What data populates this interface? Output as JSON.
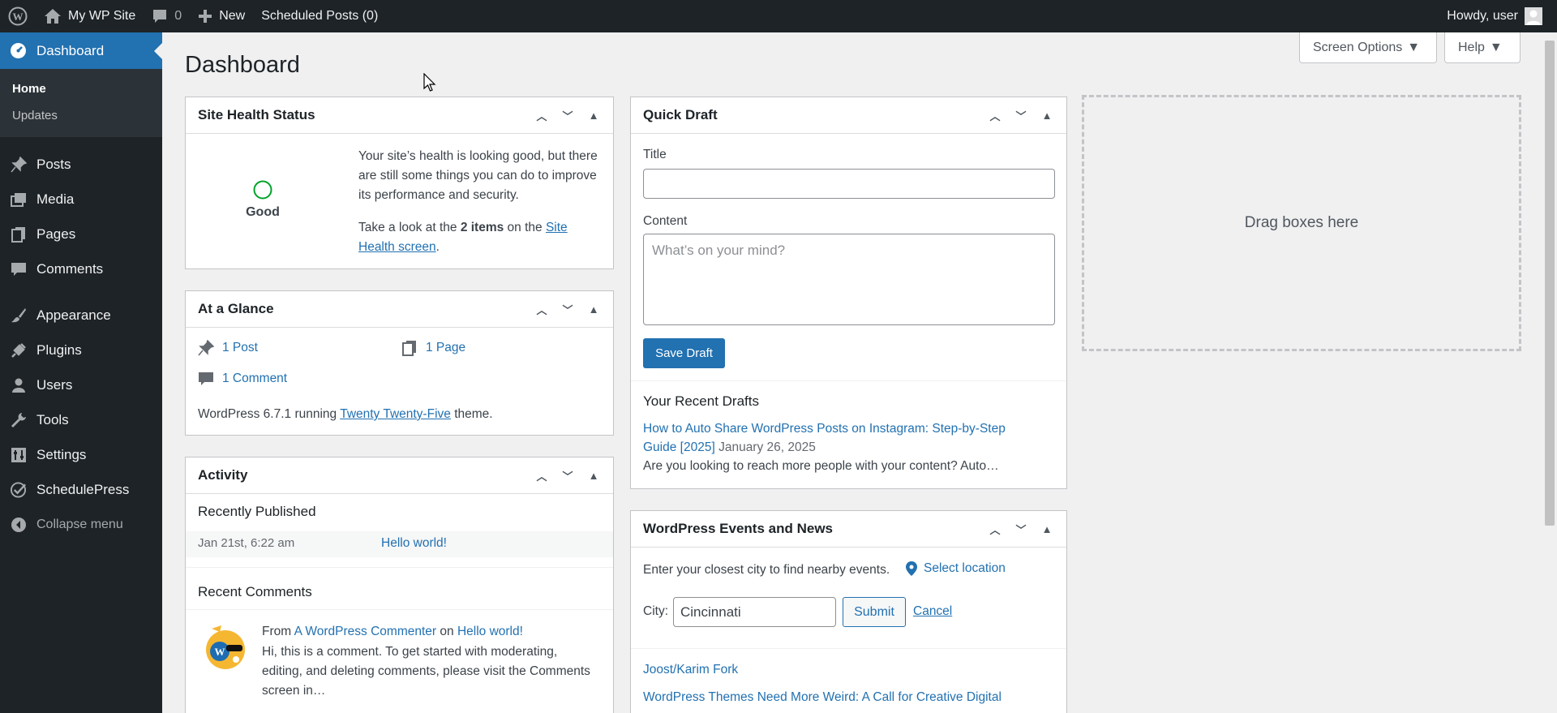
{
  "adminbar": {
    "site_name": "My WP Site",
    "comments_count": "0",
    "new_label": "New",
    "scheduled": "Scheduled Posts (0)",
    "howdy": "Howdy, user"
  },
  "sidebar": {
    "current": "Dashboard",
    "submenu": [
      "Home",
      "Updates"
    ],
    "items": [
      "Posts",
      "Media",
      "Pages",
      "Comments",
      "Appearance",
      "Plugins",
      "Users",
      "Tools",
      "Settings",
      "SchedulePress"
    ],
    "collapse": "Collapse menu"
  },
  "page": {
    "title": "Dashboard",
    "screen_options": "Screen Options",
    "help": "Help"
  },
  "site_health": {
    "title": "Site Health Status",
    "status": "Good",
    "text1": "Your site’s health is looking good, but there are still some things you can do to improve its performance and security.",
    "text2_a": "Take a look at the",
    "text2_b": "2 items",
    "text2_c": "on the",
    "text2_link": "Site Health screen",
    "text2_d": "."
  },
  "glance": {
    "title": "At a Glance",
    "posts": "1 Post",
    "pages": "1 Page",
    "comments": "1 Comment",
    "running_a": "WordPress 6.7.1 running",
    "theme": "Twenty Twenty-Five",
    "running_b": "theme."
  },
  "activity": {
    "title": "Activity",
    "recently_published": "Recently Published",
    "pub_date": "Jan 21st, 6:22 am",
    "pub_title": "Hello world!",
    "recent_comments": "Recent Comments",
    "from": "From",
    "commenter": "A WordPress Commenter",
    "on": "on",
    "post": "Hello world!",
    "comment_text": "Hi, this is a comment. To get started with moderating, editing, and deleting comments, please visit the Comments screen in…"
  },
  "quick_draft": {
    "title": "Quick Draft",
    "title_label": "Title",
    "content_label": "Content",
    "content_placeholder": "What’s on your mind?",
    "save": "Save Draft",
    "recent_drafts": "Your Recent Drafts",
    "draft_title": "How to Auto Share WordPress Posts on Instagram: Step-by-Step Guide [2025]",
    "draft_date": "January 26, 2025",
    "draft_excerpt": "Are you looking to reach more people with your content? Auto…"
  },
  "events": {
    "title": "WordPress Events and News",
    "prompt": "Enter your closest city to find nearby events.",
    "select_location": "Select location",
    "city_label": "City:",
    "city_value": "Cincinnati",
    "submit": "Submit",
    "cancel": "Cancel",
    "news1": "Joost/Karim Fork",
    "news2": "WordPress Themes Need More Weird: A Call for Creative Digital"
  },
  "drag_zone": "Drag boxes here"
}
